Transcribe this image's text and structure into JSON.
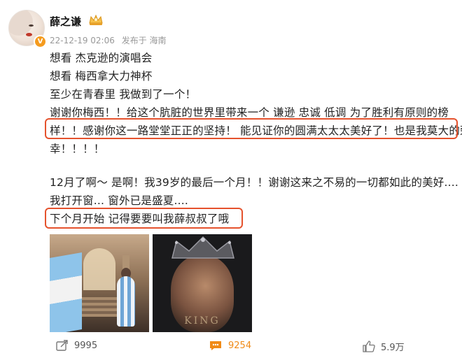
{
  "post": {
    "author": "薛之谦",
    "verified_icon": "v-badge",
    "time": "22-12-19 02:06",
    "source": "发布于 海南",
    "lines": [
      "想看 杰克逊的演唱会",
      "想看 梅西拿大力神杯",
      "至少在青春里 我做到了一个！",
      "谢谢你梅西！！给这个肮脏的世界里带来一个 谦逊 忠诚 低调 为了胜利有原则的榜",
      "样！！感谢你这一路堂堂正正的坚持！ 能见证你的圆满太太太美好了！也是我莫大的荣",
      "幸！！！！",
      "12月了啊～ 是啊！我39岁的最后一个月！！谢谢这来之不易的一切都如此的美好....",
      "我打开窗... 窗外已是盛夏....",
      "下个月开始 记得要要叫我薛叔叔了哦"
    ],
    "highlight_color": "#e5522d",
    "images": [
      "stadium-image",
      "crowned-player-image"
    ],
    "image2_caption": "KING"
  },
  "actions": {
    "share_count": "9995",
    "comment_count": "9254",
    "like_count": "5.9万",
    "comment_color": "#f08a16"
  }
}
